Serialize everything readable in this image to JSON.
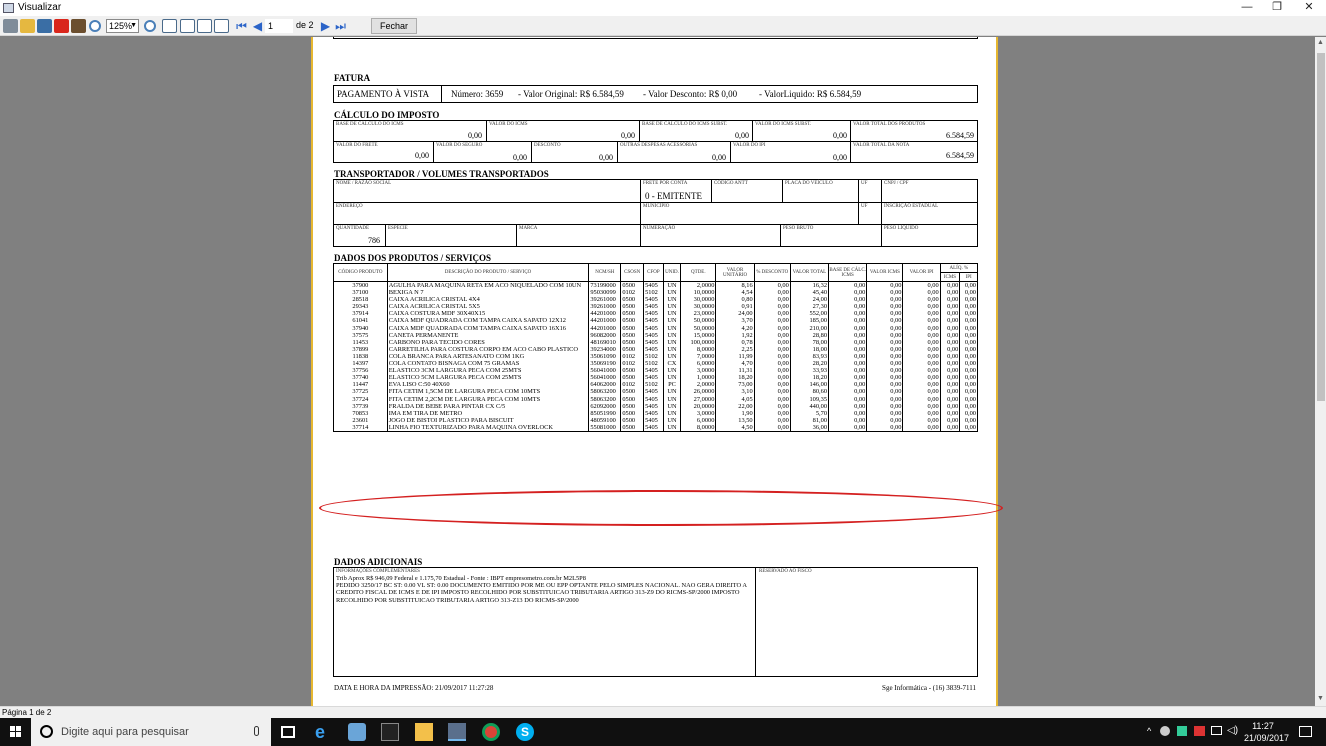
{
  "window": {
    "title": "Visualizar",
    "minimize": "—",
    "restore": "❐",
    "close": "✕"
  },
  "toolbar": {
    "zoom": "125%",
    "page_current": "1",
    "page_of": "de 2",
    "close_label": "Fechar"
  },
  "doc": {
    "fatura": {
      "heading": "FATURA",
      "payment": "PAGAMENTO À VISTA",
      "numero": "Número:   3659",
      "orig": "-   Valor Original: R$ 6.584,59",
      "desc": "-   Valor Desconto:  R$ 0,00",
      "liq": "-   ValorLiquido: R$ 6.584,59"
    },
    "imposto": {
      "heading": "CÁLCULO DO IMPOSTO",
      "r1": [
        {
          "l": "BASE DE CÁLCULO DO ICMS",
          "v": "0,00"
        },
        {
          "l": "VALOR DO ICMS",
          "v": "0,00"
        },
        {
          "l": "BASE DE CÁLCULO DO ICMS SUBST.",
          "v": "0,00"
        },
        {
          "l": "VALOR DO ICMS SUBST.",
          "v": "0,00"
        },
        {
          "l": "VALOR TOTAL DOS PRODUTOS",
          "v": "6.584,59"
        }
      ],
      "r2": [
        {
          "l": "VALOR DO FRETE",
          "v": "0,00"
        },
        {
          "l": "VALOR DO SEGURO",
          "v": "0,00"
        },
        {
          "l": "DESCONTO",
          "v": "0,00"
        },
        {
          "l": "OUTRAS DESPESAS ACESSÓRIAS",
          "v": "0,00"
        },
        {
          "l": "VALOR DO IPI",
          "v": "0,00"
        },
        {
          "l": "VALOR TOTAL DA NOTA",
          "v": "6.584,59"
        }
      ]
    },
    "transp": {
      "heading": "TRANSPORTADOR / VOLUMES TRANSPORTADOS",
      "nome": "NOME / RAZÃO SOCIAL",
      "frete": "FRETE POR CONTA",
      "frete_val": "0 - EMITENTE",
      "antt": "CÓDIGO ANTT",
      "placa": "PLACA DO VEÍCULO",
      "uf": "UF",
      "cnpj": "CNPJ / CPF",
      "endereco": "ENDEREÇO",
      "municipio": "MUNICÍPIO",
      "uf2": "UF",
      "ie": "INSCRIÇÃO ESTADUAL",
      "qtd": "QUANTIDADE",
      "qtd_val": "786",
      "especie": "ESPÉCIE",
      "marca": "MARCA",
      "numeracao": "NUMERAÇÃO",
      "peso_bruto": "PESO BRUTO",
      "peso_liq": "PESO LÍQUIDO"
    },
    "produtos": {
      "heading": "DADOS DOS PRODUTOS / SERVIÇOS",
      "headers": [
        "CÓDIGO PRODUTO",
        "DESCRIÇÃO DO PRODUTO / SERVIÇO",
        "NCM/SH",
        "CSOSN",
        "CFOP",
        "UNID.",
        "QTDE.",
        "VALOR UNITÁRIO",
        "% DESCONTO",
        "VALOR TOTAL",
        "BASE DE CÁLC. ICMS",
        "VALOR ICMS",
        "VALOR IPI",
        "ICMS",
        "IPI"
      ],
      "aliq": "ALÍQ. %",
      "rows": [
        [
          "37900",
          "AGULHA PARA MAQUINA RETA EM ACO NIQUELADO COM 10UN",
          "73199000",
          "0500",
          "5405",
          "UN",
          "2,0000",
          "8,16",
          "0,00",
          "16,32",
          "0,00",
          "0,00",
          "0,00",
          "0,00",
          "0,00"
        ],
        [
          "37100",
          "BEXIGA N 7",
          "95030099",
          "0102",
          "5102",
          "UN",
          "10,0000",
          "4,54",
          "0,00",
          "45,40",
          "0,00",
          "0,00",
          "0,00",
          "0,00",
          "0,00"
        ],
        [
          "28518",
          "CAIXA ACRILICA CRISTAL 4X4",
          "39261000",
          "0500",
          "5405",
          "UN",
          "30,0000",
          "0,80",
          "0,00",
          "24,00",
          "0,00",
          "0,00",
          "0,00",
          "0,00",
          "0,00"
        ],
        [
          "29343",
          "CAIXA ACRILICA CRISTAL 5X5",
          "39261000",
          "0500",
          "5405",
          "UN",
          "30,0000",
          "0,91",
          "0,00",
          "27,30",
          "0,00",
          "0,00",
          "0,00",
          "0,00",
          "0,00"
        ],
        [
          "37914",
          "CAIXA COSTURA MDF 30X40X15",
          "44201000",
          "0500",
          "5405",
          "UN",
          "23,0000",
          "24,00",
          "0,00",
          "552,00",
          "0,00",
          "0,00",
          "0,00",
          "0,00",
          "0,00"
        ],
        [
          "61041",
          "CAIXA MDF QUADRADA COM TAMPA CAIXA SAPATO 12X12",
          "44201000",
          "0500",
          "5405",
          "UN",
          "50,0000",
          "3,70",
          "0,00",
          "185,00",
          "0,00",
          "0,00",
          "0,00",
          "0,00",
          "0,00"
        ],
        [
          "37940",
          "CAIXA MDF QUADRADA COM TAMPA CAIXA SAPATO 16X16",
          "44201000",
          "0500",
          "5405",
          "UN",
          "50,0000",
          "4,20",
          "0,00",
          "210,00",
          "0,00",
          "0,00",
          "0,00",
          "0,00",
          "0,00"
        ],
        [
          "37575",
          "CANETA PERMANENTE",
          "96082000",
          "0500",
          "5405",
          "UN",
          "15,0000",
          "1,92",
          "0,00",
          "28,80",
          "0,00",
          "0,00",
          "0,00",
          "0,00",
          "0,00"
        ],
        [
          "11453",
          "CARBONO PARA TECIDO CORES",
          "48169010",
          "0500",
          "5405",
          "UN",
          "100,0000",
          "0,78",
          "0,00",
          "78,00",
          "0,00",
          "0,00",
          "0,00",
          "0,00",
          "0,00"
        ],
        [
          "37899",
          "CARRETILHA PARA COSTURA CORPO EM ACO CABO PLASTICO",
          "39234000",
          "0500",
          "5405",
          "UN",
          "8,0000",
          "2,25",
          "0,00",
          "18,00",
          "0,00",
          "0,00",
          "0,00",
          "0,00",
          "0,00"
        ],
        [
          "11838",
          "COLA BRANCA PARA ARTESANATO COM 1KG",
          "35061090",
          "0102",
          "5102",
          "UN",
          "7,0000",
          "11,99",
          "0,00",
          "83,93",
          "0,00",
          "0,00",
          "0,00",
          "0,00",
          "0,00"
        ],
        [
          "14397",
          "COLA CONTATO BISNAGA COM 75 GRAMAS",
          "35069190",
          "0102",
          "5102",
          "CX",
          "6,0000",
          "4,70",
          "0,00",
          "28,20",
          "0,00",
          "0,00",
          "0,00",
          "0,00",
          "0,00"
        ],
        [
          "37756",
          "ELASTICO 3CM LARGURA PECA COM 25MTS",
          "56041000",
          "0500",
          "5405",
          "UN",
          "3,0000",
          "11,31",
          "0,00",
          "33,93",
          "0,00",
          "0,00",
          "0,00",
          "0,00",
          "0,00"
        ],
        [
          "37740",
          "ELASTICO 5CM LARGURA PECA COM 25MTS",
          "56041000",
          "0500",
          "5405",
          "UN",
          "1,0000",
          "18,20",
          "0,00",
          "18,20",
          "0,00",
          "0,00",
          "0,00",
          "0,00",
          "0,00"
        ],
        [
          "11447",
          "EVA LISO C:50 40X60",
          "64062000",
          "0102",
          "5102",
          "PC",
          "2,0000",
          "73,00",
          "0,00",
          "146,00",
          "0,00",
          "0,00",
          "0,00",
          "0,00",
          "0,00"
        ],
        [
          "37725",
          "FITA CETIM 1,5CM DE LARGURA PECA COM 10MTS",
          "58063200",
          "0500",
          "5405",
          "UN",
          "26,0000",
          "3,10",
          "0,00",
          "80,60",
          "0,00",
          "0,00",
          "0,00",
          "0,00",
          "0,00"
        ],
        [
          "37724",
          "FITA CETIM 2,2CM DE LARGURA PECA COM 10MTS",
          "58063200",
          "0500",
          "5405",
          "UN",
          "27,0000",
          "4,05",
          "0,00",
          "109,35",
          "0,00",
          "0,00",
          "0,00",
          "0,00",
          "0,00"
        ],
        [
          "37739",
          "FRALDA DE BEBE PARA PINTAR CX C/5",
          "62092000",
          "0500",
          "5405",
          "UN",
          "20,0000",
          "22,00",
          "0,00",
          "440,00",
          "0,00",
          "0,00",
          "0,00",
          "0,00",
          "0,00"
        ],
        [
          "70853",
          "IMA EM TIRA DE METRO",
          "85051990",
          "0500",
          "5405",
          "UN",
          "3,0000",
          "1,90",
          "0,00",
          "5,70",
          "0,00",
          "0,00",
          "0,00",
          "0,00",
          "0,00"
        ],
        [
          "23601",
          "JOGO DE BISTOI PLASTICO PARA BISCUIT",
          "48059100",
          "0500",
          "5405",
          "UN",
          "6,0000",
          "13,50",
          "0,00",
          "81,00",
          "0,00",
          "0,00",
          "0,00",
          "0,00",
          "0,00"
        ],
        [
          "37714",
          "LINHA FIO TEXTURIZADO PARA MAQUINA OVERLOCK",
          "55081000",
          "0500",
          "5405",
          "UN",
          "8,0000",
          "4,50",
          "0,00",
          "36,00",
          "0,00",
          "0,00",
          "0,00",
          "0,00",
          "0,00"
        ]
      ]
    },
    "adicionais": {
      "heading": "DADOS ADICIONAIS",
      "info_label": "INFORMAÇÕES COMPLEMENTARES",
      "info_line1": "Trib Aprox R$ 946,09 Federal e 1.175,70 Estadual - Fonte : IBPT empresometro.com.br M2L5P8",
      "info_line2": "PEDIDO 3250/17 BC ST: 0.00 VL ST: 0.00 DOCUMENTO EMITIDO POR ME OU EPP OPTANTE PELO SIMPLES NACIONAL. NAO GERA DIREITO A CREDITO FISCAL DE ICMS E DE IPI IMPOSTO RECOLHIDO POR SUBSTITUICAO TRIBUTARIA ARTIGO 313-Z9 DO RICMS-SP/2000 IMPOSTO RECOLHIDO POR SUBSTITUICAO TRIBUTARIA ARTIGO 313-Z13 DO RICMS-SP/2000",
      "fisco_label": "RESERVADO AO FISCO"
    },
    "footer": {
      "print": "DATA E HORA DA IMPRESSÃO: 21/09/2017 11:27:28",
      "company": "Sge Informática - (16) 3839-7111"
    }
  },
  "status": {
    "page": "Página 1 de 2"
  },
  "taskbar": {
    "search_placeholder": "Digite aqui para pesquisar",
    "time": "11:27",
    "date": "21/09/2017"
  },
  "colors": {
    "page_border": "#e6b730",
    "annotation": "#d42020",
    "viewer_bg": "#808080"
  }
}
